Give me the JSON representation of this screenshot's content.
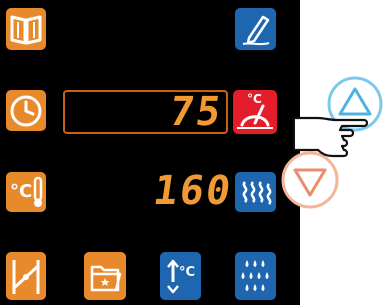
{
  "colors": {
    "orange": "#e8892b",
    "blue": "#1f66b0",
    "red": "#e31d2a",
    "segment": "#f19a35",
    "up_ring": "#7ec8ec",
    "down_ring": "#f3b59a"
  },
  "tiles": {
    "book": {
      "icon": "book-icon"
    },
    "edit": {
      "icon": "pencil-icon"
    },
    "timer": {
      "icon": "clock-icon"
    },
    "core_temp_mode": {
      "icon": "thermometer-probe-icon"
    },
    "core_probe": {
      "icon": "thermometer-icon"
    },
    "humidity": {
      "icon": "steam-icon"
    },
    "fan": {
      "icon": "fan-speed-icon"
    },
    "folder": {
      "icon": "folder-star-icon"
    },
    "cool_down": {
      "icon": "cool-down-icon"
    },
    "moisture": {
      "icon": "water-drops-icon"
    }
  },
  "display": {
    "time_value": "75",
    "temp_value": "160"
  },
  "labels": {
    "celsius": "°C"
  },
  "external": {
    "up_button": {
      "icon": "triangle-up-icon"
    },
    "down_button": {
      "icon": "triangle-down-icon"
    },
    "hand": {
      "icon": "pointing-hand-icon"
    }
  }
}
